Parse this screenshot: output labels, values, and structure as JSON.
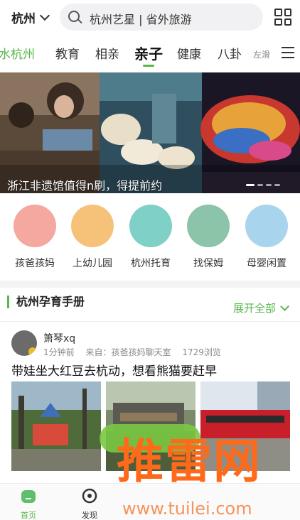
{
  "header": {
    "city": "杭州",
    "search_placeholder": "杭州艺星 | 省外旅游"
  },
  "tabs": {
    "items": [
      "水杭州",
      "教育",
      "相亲",
      "亲子",
      "健康",
      "八卦"
    ],
    "active": "亲子",
    "swipe_hint": "左滑"
  },
  "banner": {
    "caption": "浙江非遗馆值得n刷，得提前约"
  },
  "quick_links": [
    {
      "label": "孩爸孩妈",
      "color": "#f4a8a0"
    },
    {
      "label": "上幼儿园",
      "color": "#f6c27a"
    },
    {
      "label": "杭州托育",
      "color": "#7fd0c6"
    },
    {
      "label": "找保姆",
      "color": "#8bc4a8"
    },
    {
      "label": "母婴闲置",
      "color": "#a9d4ee"
    }
  ],
  "section": {
    "title": "杭州孕育手册",
    "expand": "展开全部"
  },
  "post": {
    "username": "箫琴xq",
    "time": "1分钟前",
    "source": "来自：孩爸孩妈聊天室",
    "views": "1729浏览",
    "title": "带娃坐大红豆去杭动，想看熊猫要赶早"
  },
  "bottom_nav": [
    {
      "label": "首页",
      "active": true
    },
    {
      "label": "发现",
      "active": false
    }
  ],
  "watermark": {
    "brand": "推雷网",
    "url": "www.tuilei.com"
  },
  "colors": {
    "accent": "#56b84a",
    "watermark": "#ff6a1a"
  }
}
